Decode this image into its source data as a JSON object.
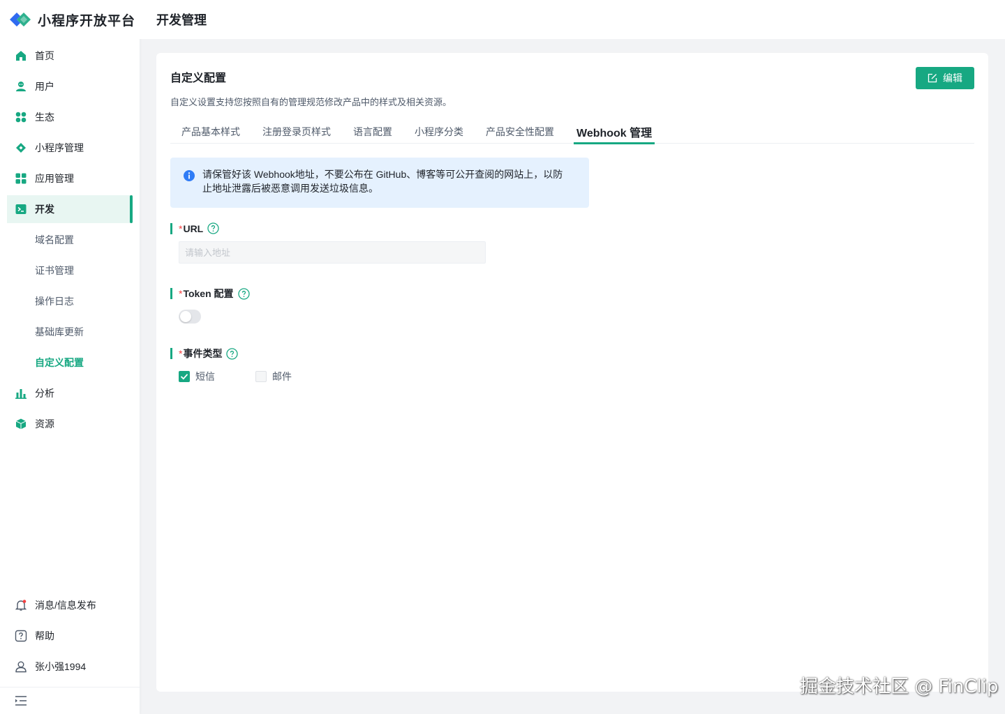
{
  "app": {
    "name": "小程序开放平台",
    "accent_color": "#17a882"
  },
  "header": {
    "title": "开发管理"
  },
  "sidebar": {
    "items": [
      {
        "label": "首页",
        "icon": "home-icon"
      },
      {
        "label": "用户",
        "icon": "user-icon"
      },
      {
        "label": "生态",
        "icon": "ecosystem-icon"
      },
      {
        "label": "小程序管理",
        "icon": "diamond-icon"
      },
      {
        "label": "应用管理",
        "icon": "apps-grid-icon"
      },
      {
        "label": "开发",
        "icon": "terminal-icon",
        "active": true
      }
    ],
    "sub_items": [
      {
        "label": "域名配置"
      },
      {
        "label": "证书管理"
      },
      {
        "label": "操作日志"
      },
      {
        "label": "基础库更新"
      },
      {
        "label": "自定义配置",
        "current": true
      }
    ],
    "items_after": [
      {
        "label": "分析",
        "icon": "bar-chart-icon"
      },
      {
        "label": "资源",
        "icon": "cube-icon"
      }
    ],
    "bottom": [
      {
        "label": "消息/信息发布",
        "icon": "bell-icon"
      },
      {
        "label": "帮助",
        "icon": "help-icon"
      },
      {
        "label": "张小强1994",
        "icon": "account-icon"
      }
    ]
  },
  "card": {
    "title": "自定义配置",
    "description": "自定义设置支持您按照自有的管理规范修改产品中的样式及相关资源。",
    "edit_label": "编辑",
    "tabs": [
      {
        "label": "产品基本样式"
      },
      {
        "label": "注册登录页样式"
      },
      {
        "label": "语言配置"
      },
      {
        "label": "小程序分类"
      },
      {
        "label": "产品安全性配置"
      },
      {
        "label": "Webhook 管理",
        "active": true
      }
    ],
    "alert": {
      "line1": "请保管好该 Webhook地址，不要公布在 GitHub、博客等可公开查阅的网站上，以防",
      "line2": "止地址泄露后被恶意调用发送垃圾信息。"
    },
    "fields": {
      "url": {
        "label": "URL",
        "required_mark": "*",
        "placeholder": "请输入地址",
        "value": ""
      },
      "token": {
        "label": "Token 配置",
        "required_mark": "*",
        "enabled": false
      },
      "event_type": {
        "label": "事件类型",
        "required_mark": "*",
        "options": [
          {
            "label": "短信",
            "checked": true
          },
          {
            "label": "邮件",
            "checked": false
          }
        ]
      }
    }
  },
  "watermark": "掘金技术社区 @ FinClip"
}
